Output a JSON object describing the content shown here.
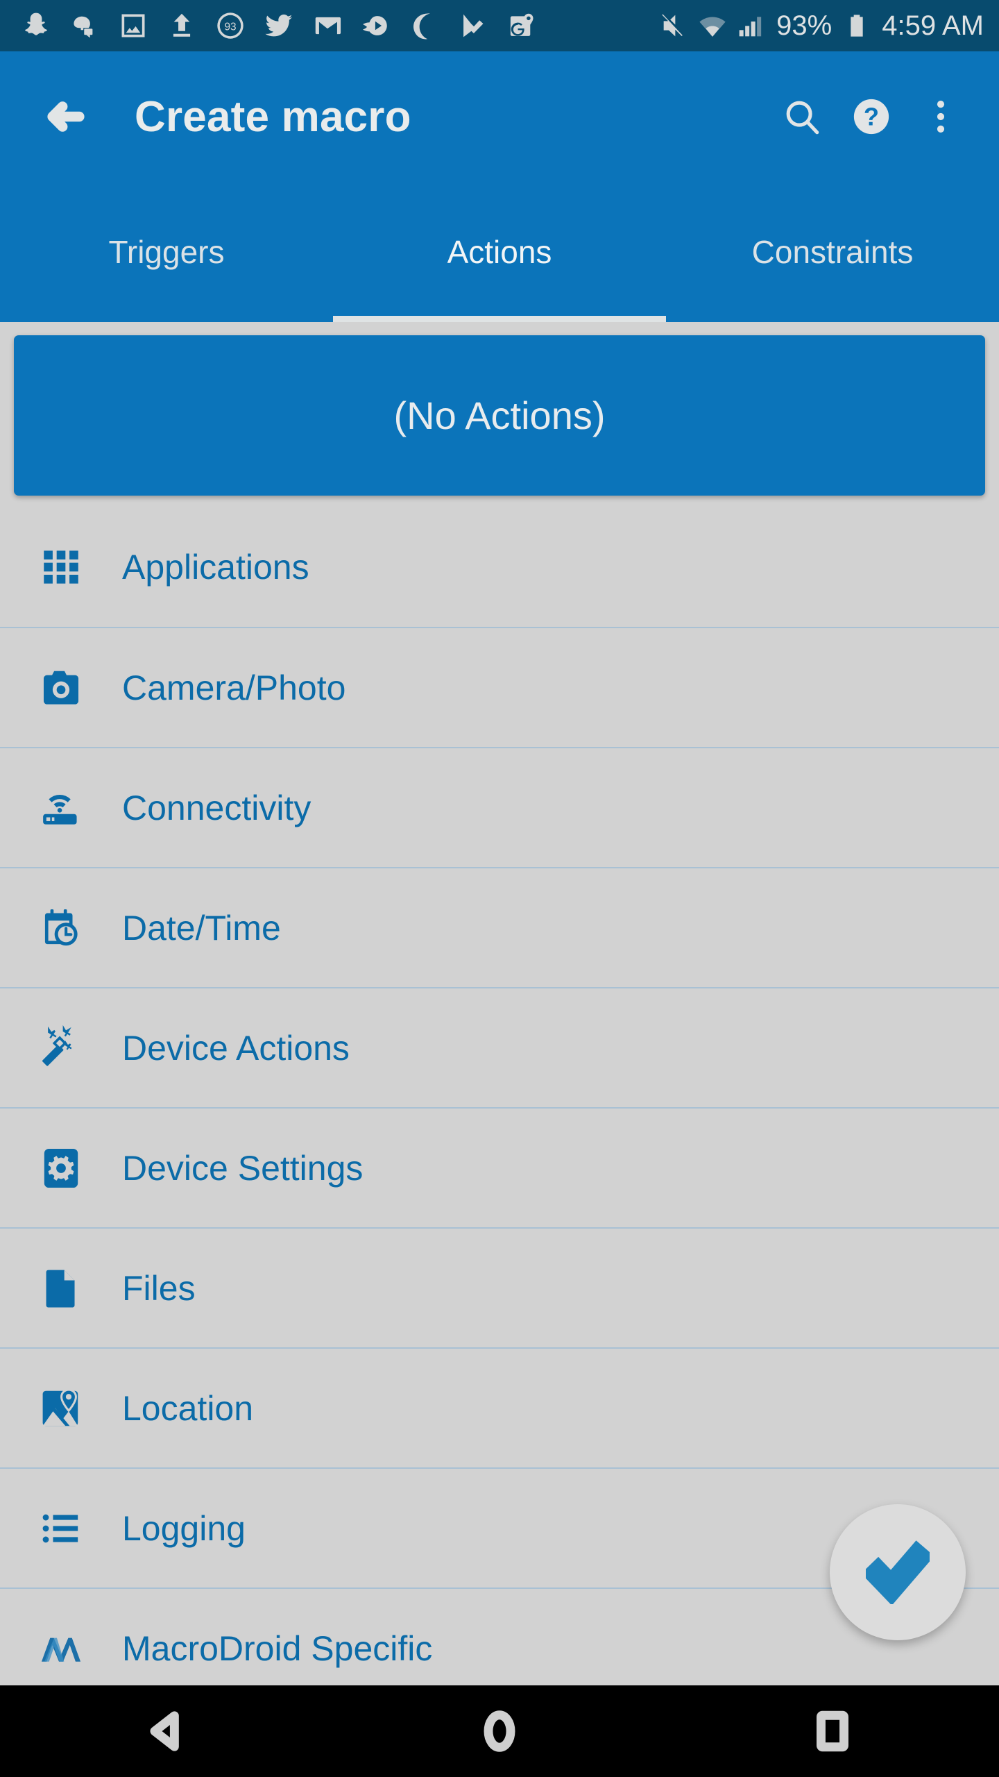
{
  "status_bar": {
    "left_icons": [
      {
        "name": "snapchat-icon"
      },
      {
        "name": "discord-icon"
      },
      {
        "name": "photo-icon"
      },
      {
        "name": "upload-icon"
      },
      {
        "name": "battery-circle-93-icon",
        "label": "93"
      },
      {
        "name": "twitter-icon"
      },
      {
        "name": "gmail-icon"
      },
      {
        "name": "media-play-icon"
      },
      {
        "name": "do-not-disturb-moon-icon"
      },
      {
        "name": "tasks-check-icon"
      },
      {
        "name": "google-maps-icon",
        "label": "G"
      }
    ],
    "right_icons": [
      {
        "name": "volume-mute-icon"
      },
      {
        "name": "wifi-icon"
      },
      {
        "name": "cellular-signal-icon"
      },
      {
        "name": "battery-icon"
      }
    ],
    "battery_percent": "93%",
    "clock": "4:59 AM"
  },
  "app_bar": {
    "back_label": "Back",
    "title": "Create macro",
    "search_label": "Search",
    "help_label": "Help",
    "overflow_label": "More options"
  },
  "tabs": {
    "items": [
      {
        "label": "Triggers",
        "active": false
      },
      {
        "label": "Actions",
        "active": true
      },
      {
        "label": "Constraints",
        "active": false
      }
    ]
  },
  "banner": {
    "text": "(No Actions)"
  },
  "list": {
    "items": [
      {
        "label": "Applications",
        "icon": "apps-grid-icon"
      },
      {
        "label": "Camera/Photo",
        "icon": "camera-icon"
      },
      {
        "label": "Connectivity",
        "icon": "router-wifi-icon"
      },
      {
        "label": "Date/Time",
        "icon": "calendar-clock-icon"
      },
      {
        "label": "Device Actions",
        "icon": "magic-wand-icon"
      },
      {
        "label": "Device Settings",
        "icon": "gear-tile-icon"
      },
      {
        "label": "Files",
        "icon": "document-icon"
      },
      {
        "label": "Location",
        "icon": "map-pin-icon"
      },
      {
        "label": "Logging",
        "icon": "bullet-list-icon"
      },
      {
        "label": "MacroDroid Specific",
        "icon": "macrodroid-logo-icon"
      }
    ]
  },
  "fab": {
    "label": "Confirm",
    "icon": "check-icon"
  },
  "nav_bar": {
    "back_label": "Back",
    "home_label": "Home",
    "recents_label": "Recent apps"
  },
  "colors": {
    "status_bar": "#084b6e",
    "app_bar": "#0b74ba",
    "accent": "#0b6ba8",
    "background": "#d2d2d2",
    "divider": "#a9c1d4",
    "fab_bg": "#dcdcdc",
    "fab_check": "#2084bd"
  }
}
